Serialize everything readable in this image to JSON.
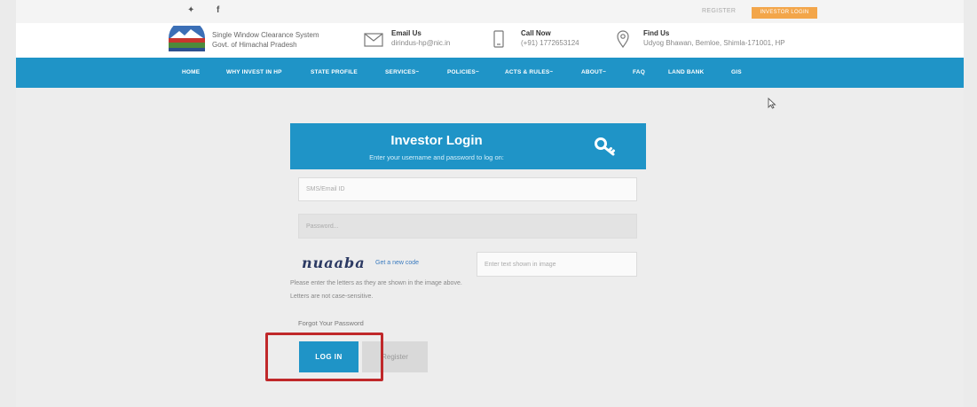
{
  "topbar": {
    "twitter_glyph": "✦",
    "facebook_glyph": "f",
    "register_link": "REGISTER",
    "investor_login_button": "INVESTOR LOGIN"
  },
  "header": {
    "site_name_line1": "Single Window Clearance System",
    "site_name_line2": "Govt. of Himachal Pradesh",
    "email_title": "Email Us",
    "email_value": "dirindus-hp@nic.in",
    "call_title": "Call Now",
    "call_value": "(+91) 1772653124",
    "find_title": "Find Us",
    "find_value": "Udyog Bhawan, Bemloe, Shimla-171001, HP"
  },
  "nav": {
    "items": [
      "HOME",
      "WHY INVEST IN HP",
      "STATE PROFILE",
      "SERVICES~",
      "POLICIES~",
      "ACTS & RULES~",
      "ABOUT~",
      "FAQ",
      "LAND BANK",
      "GIS"
    ]
  },
  "login": {
    "title": "Investor Login",
    "subtitle": "Enter your username and password to log on:",
    "email_placeholder": "SMS/Email ID",
    "password_placeholder": "Password...",
    "captcha_text": "nuaaba",
    "new_code_link": "Get a new code",
    "captcha_placeholder": "Enter text shown in image",
    "help_line1": "Please enter the letters as they are shown in the image above.",
    "help_line2": "Letters are not case-sensitive.",
    "forgot_link": "Forgot Your Password",
    "login_button": "LOG IN",
    "register_button": "Register"
  },
  "colors": {
    "brand_blue": "#1f94c7",
    "accent_orange": "#f3a64a",
    "highlight_red": "#c0282a"
  }
}
